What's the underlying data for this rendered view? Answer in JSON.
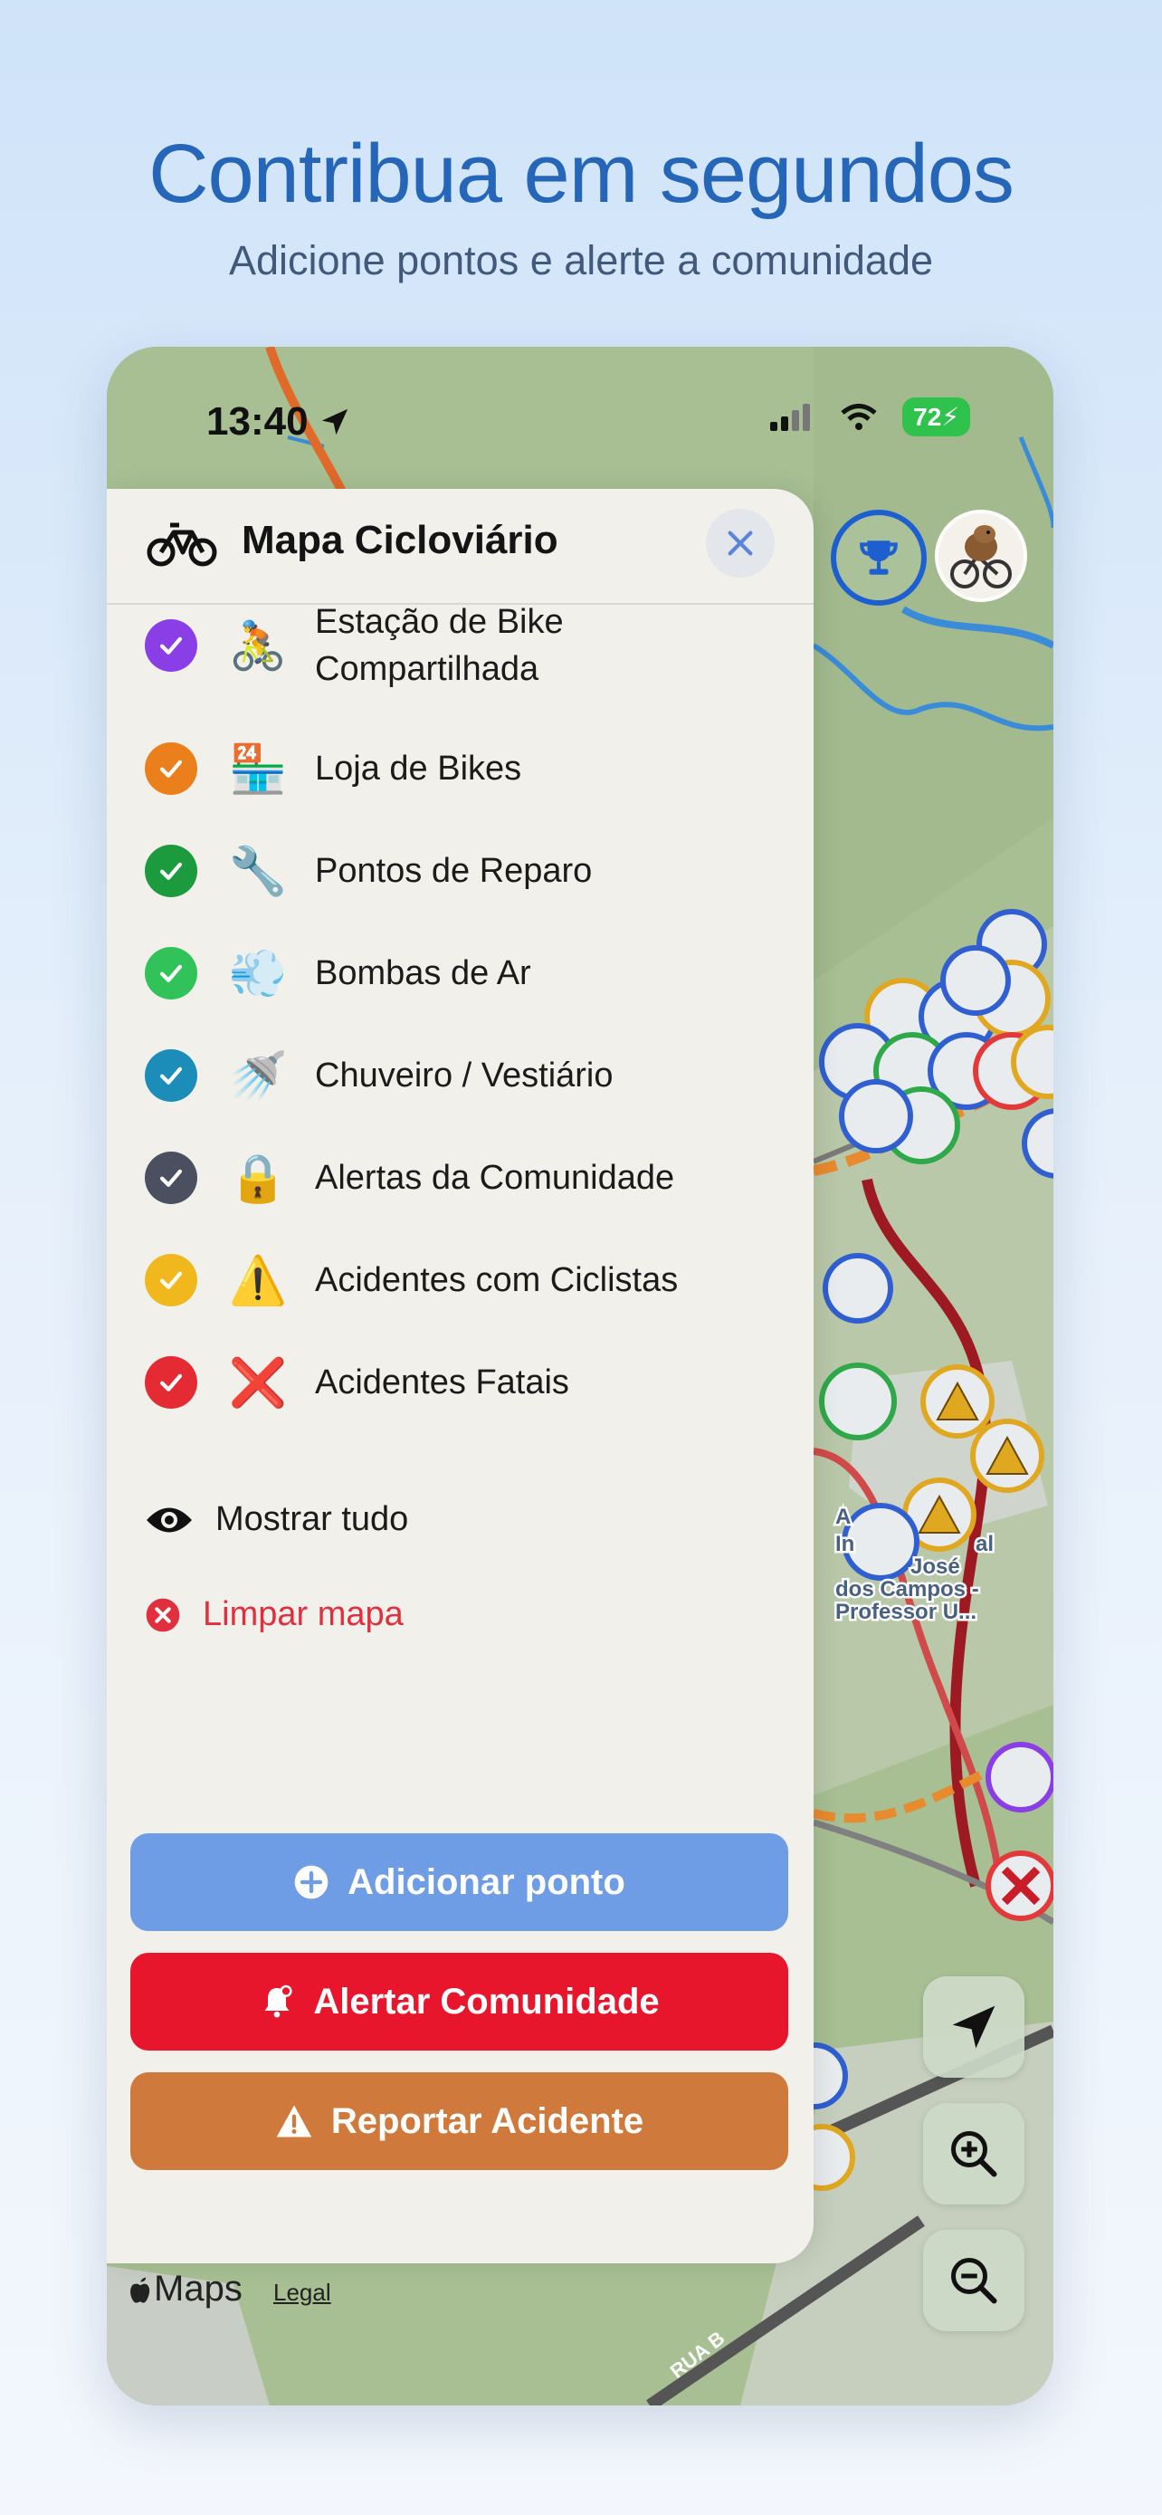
{
  "headline": "Contribua em segundos",
  "subheadline": "Adicione pontos e alerte a comunidade",
  "status_bar": {
    "time": "13:40",
    "battery": "72"
  },
  "panel": {
    "title": "Mapa Cicloviário",
    "layers": [
      {
        "line1": "Estação de Bike",
        "line2": "Compartilhada",
        "emoji": "🚴",
        "color": "#8a3ee6"
      },
      {
        "line1": "Loja de Bikes",
        "line2": "",
        "emoji": "🏪",
        "color": "#ea7f1c"
      },
      {
        "line1": "Pontos de Reparo",
        "line2": "",
        "emoji": "🔧",
        "color": "#1c9a3e"
      },
      {
        "line1": "Bombas de Ar",
        "line2": "",
        "emoji": "💨",
        "color": "#31c35a"
      },
      {
        "line1": "Chuveiro / Vestiário",
        "line2": "",
        "emoji": "🚿",
        "color": "#1b8db8"
      },
      {
        "line1": "Alertas da Comunidade",
        "line2": "",
        "emoji": "🔒",
        "color": "#4a5060"
      },
      {
        "line1": "Acidentes com Ciclistas",
        "line2": "",
        "emoji": "⚠️",
        "color": "#f0b81c"
      },
      {
        "line1": "Acidentes Fatais",
        "line2": "",
        "emoji": "❌",
        "color": "#e42a33"
      }
    ],
    "show_all": "Mostrar tudo",
    "clear_map": "Limpar mapa",
    "actions": {
      "add": "Adicionar ponto",
      "alert": "Alertar Comunidade",
      "report": "Reportar Acidente"
    }
  },
  "map": {
    "poi_label_lines": [
      "A",
      "In",
      "al",
      "José",
      "dos Campos -",
      "Professor U..."
    ],
    "road_label": "RUA B",
    "maps_brand": "Maps",
    "legal": "Legal"
  },
  "icons": {
    "trophy": "trophy-icon",
    "avatar": "capybara-cyclist-avatar",
    "locate": "location-arrow-icon",
    "zoom_in": "zoom-in-icon",
    "zoom_out": "zoom-out-icon"
  }
}
